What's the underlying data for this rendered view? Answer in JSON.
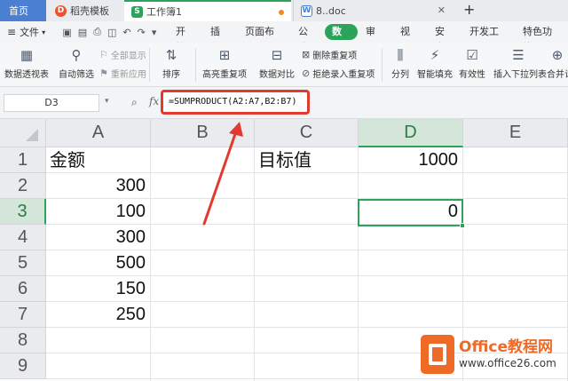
{
  "tabs": {
    "home": "首页",
    "template": "稻壳模板",
    "workbook": "工作簿1",
    "doc": "8..doc",
    "close_glyph": "✕",
    "new_tab_glyph": "+"
  },
  "menu": {
    "file": "文件",
    "items": [
      "开始",
      "插入",
      "页面布局",
      "公式",
      "数据",
      "审阅",
      "视图",
      "安全",
      "开发工具",
      "特色功能"
    ],
    "active": "数据"
  },
  "ribbon": {
    "pivot": "数据透视表",
    "autofilter": "自动筛选",
    "show_all": "全部显示",
    "reapply": "重新应用",
    "sort": "排序",
    "highlight_dup": "高亮重复项",
    "compare": "数据对比",
    "delete_dup": "删除重复项",
    "reject_dup": "拒绝录入重复项",
    "split": "分列",
    "flash_fill": "智能填充",
    "validity": "有效性",
    "dropdown": "插入下拉列表",
    "merge": "合并计"
  },
  "formula_bar": {
    "cell_ref": "D3",
    "fx": "fx",
    "formula": "=SUMPRODUCT(A2:A7,B2:B7)"
  },
  "sheet": {
    "columns": [
      "A",
      "B",
      "C",
      "D",
      "E"
    ],
    "active_column": "D",
    "rows": [
      "1",
      "2",
      "3",
      "4",
      "5",
      "6",
      "7",
      "8",
      "9"
    ],
    "active_row": "3",
    "cells": {
      "A1": "金额",
      "A2": "300",
      "A3": "100",
      "A4": "300",
      "A5": "500",
      "A6": "150",
      "A7": "250",
      "C1": "目标值",
      "D1": "1000",
      "D3": "0"
    }
  },
  "watermark": {
    "name": "Office教程网",
    "url": "www.office26.com"
  },
  "colors": {
    "accent_green": "#2ca35a",
    "highlight_red": "#e23a2e",
    "watermark_orange": "#ef6a26"
  }
}
